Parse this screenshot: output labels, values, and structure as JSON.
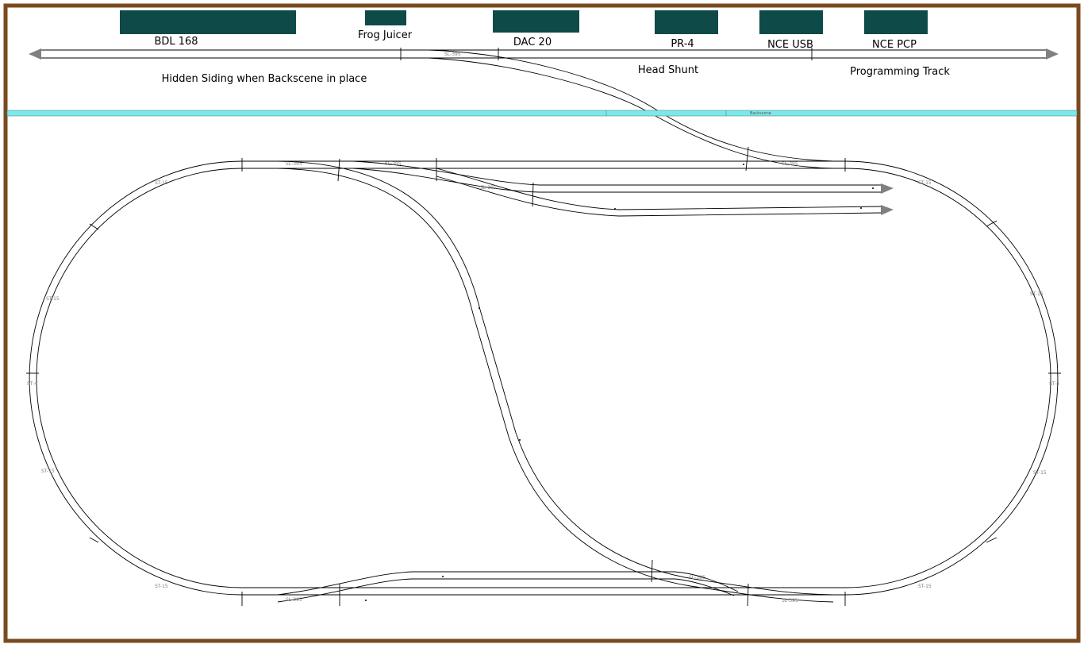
{
  "colors": {
    "frame": "#7a4a1f",
    "equipment": "#0d4a48",
    "backscene": "#7ee8e8",
    "track": "#000000",
    "arrow": "#808080",
    "part_label": "#808080"
  },
  "equipment": [
    {
      "label": "BDL 168"
    },
    {
      "label": "Frog Juicer"
    },
    {
      "label": "DAC 20"
    },
    {
      "label": "PR-4"
    },
    {
      "label": "NCE USB"
    },
    {
      "label": "NCE PCP"
    }
  ],
  "annotations": {
    "hidden_siding": "Hidden Siding when Backscene in place",
    "head_shunt": "Head Shunt",
    "programming_track": "Programming Track",
    "backscene": "Backscene"
  },
  "part_labels": {
    "point": "SL-395",
    "curve": "ST-15",
    "straight": "ST-4"
  }
}
